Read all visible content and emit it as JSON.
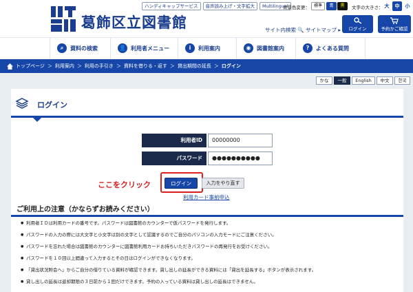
{
  "header": {
    "site_name": "葛飾区立図書館",
    "util_buttons": [
      "ハンディキャップサービス",
      "音声読み上げ・文字拡大",
      "Multilingual"
    ],
    "bg_color_label": "背景色変更：",
    "bg_standard": "標準",
    "bg_blue": "青",
    "bg_black": "黒",
    "text_size_label": "文字の大きさ：",
    "size_large": "大",
    "size_medium": "中",
    "size_small": "小",
    "site_search": "サイト内検索",
    "site_map": "サイトマップ",
    "login_label": "ログイン",
    "cart_label": "予約かご確認",
    "colors": {
      "brand": "#1546a8",
      "dark": "#1b2a4a"
    }
  },
  "nav": {
    "items": [
      {
        "label": "資料の検索",
        "icon": "search-icon"
      },
      {
        "label": "利用者メニュー",
        "icon": "user-icon"
      },
      {
        "label": "利用案内",
        "icon": "info-icon"
      },
      {
        "label": "図書館案内",
        "icon": "location-pin-icon"
      },
      {
        "label": "よくある質問",
        "icon": "question-icon"
      }
    ]
  },
  "breadcrumb": {
    "items": [
      "トップページ",
      "利用案内",
      "利用の手引き",
      "資料を借りる・返す",
      "貸出期間の延長"
    ],
    "current": "ログイン"
  },
  "languages": [
    "かな",
    "一般",
    "English",
    "中文",
    "한국"
  ],
  "page": {
    "title": "ログイン",
    "form": {
      "user_id_label": "利用者ID",
      "user_id_value": "00000000",
      "password_label": "パスワード",
      "password_value": "●●●●●●●●●●"
    },
    "hint": "ここをクリック",
    "login_button": "ログイン",
    "reset_button": "入力をやり直す",
    "preregister_link": "利用カード事前申込",
    "notice_title": "ご利用上の注意（かならずお読みください）",
    "notices": [
      "利用者ＩＤは利用カードの番号です。パスワードは図書館のカウンターで仮パスワードを発行します。",
      "パスワードの入力の際には大文字と小文字は別の文字として認識するのでご自分のパソコンの入力モードにご注意ください。",
      "パスワードを忘れた場合は図書館のカウンターに図書館利用カードお持ちいただきパスワードの再発行をお受けください。",
      "パスワードを１０回以上間違って入力するとその日はログインができなくなります。",
      "「貸出状況照会へ」からご自分の借りている資料が確認できます。貸し出しの延長ができる資料には「貸出を延長する」ボタンが表示されます。",
      "貸し出しの延長は返却期限の３日前から１回だけできます。予約の入っている資料は貸し出しの延長はできません。"
    ]
  }
}
